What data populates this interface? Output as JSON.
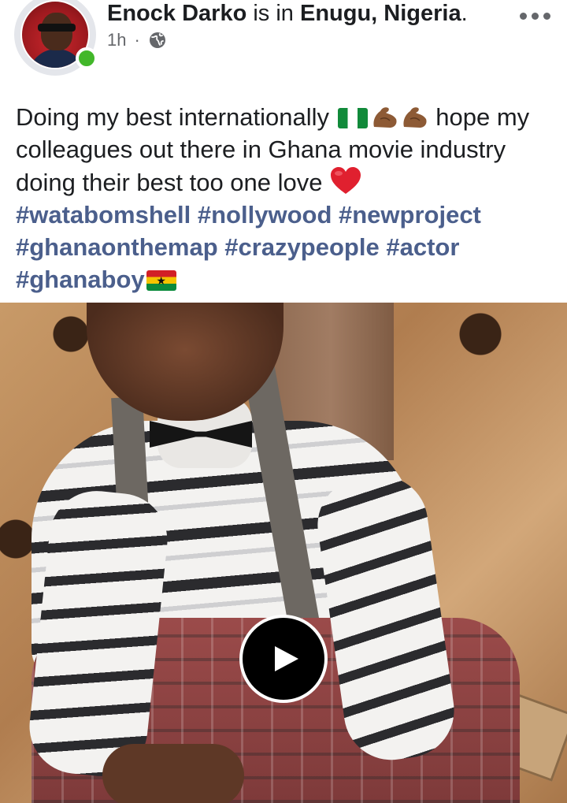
{
  "post": {
    "author": {
      "name": "Enock Darko",
      "connector": " is in ",
      "location": "Enugu, Nigeria",
      "suffix": ".",
      "online": true
    },
    "time": "1h",
    "separator": "·",
    "audience_icon": "globe-icon",
    "more_icon": "more-options-icon",
    "text_part1": "Doing my best internationally ",
    "text_part2": " hope my colleagues out there in Ghana movie industry doing their best too one love ",
    "emojis": [
      "nigeria-flag",
      "flexed-biceps",
      "flexed-biceps",
      "red-heart"
    ],
    "hashtags": [
      "#watabomshell",
      "#nollywood",
      "#newproject",
      "#ghanaonthemap",
      "#crazypeople",
      "#actor",
      "#ghanaboy"
    ],
    "trailing_emoji": "ghana-flag",
    "media": {
      "type": "video",
      "play_icon": "play-icon"
    }
  },
  "colors": {
    "text": "#1c1e21",
    "meta": "#65676b",
    "hashtag": "#4b5f8c",
    "online": "#42b72a",
    "play_bg": "#000000"
  }
}
